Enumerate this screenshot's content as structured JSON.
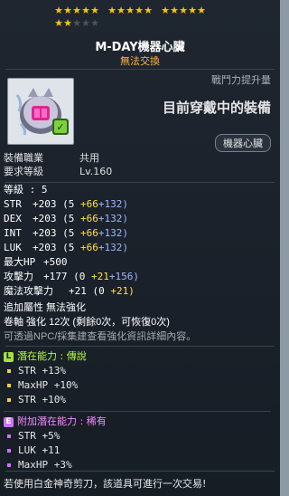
{
  "stars": {
    "filled": 17,
    "total": 20
  },
  "item": {
    "name": "M-DAY機器心臟",
    "subtitle": "無法交換",
    "icon": "mechanical-heart-icon"
  },
  "compare": {
    "label": "戰鬥力提升量",
    "main": "目前穿戴中的裝備",
    "badge": "機器心臟"
  },
  "requirements": [
    {
      "label": "裝備職業",
      "value": "共用"
    },
    {
      "label": "要求等級",
      "value": "Lv.160"
    }
  ],
  "stats": {
    "level": "等級 : 5",
    "lines": [
      {
        "name": "STR",
        "total": "+203",
        "open": "(5",
        "a": "+66",
        "b": "+132)"
      },
      {
        "name": "DEX",
        "total": "+203",
        "open": "(5",
        "a": "+66",
        "b": "+132)"
      },
      {
        "name": "INT",
        "total": "+203",
        "open": "(5",
        "a": "+66",
        "b": "+132)"
      },
      {
        "name": "LUK",
        "total": "+203",
        "open": "(5",
        "a": "+66",
        "b": "+132)"
      }
    ],
    "maxhp": {
      "name": "最大HP",
      "value": "+500"
    },
    "attack": {
      "name": "攻擊力",
      "total": "+177",
      "open": "(0",
      "a": "+21",
      "b": "+156)"
    },
    "magic": {
      "name": "魔法攻擊力",
      "total": "+21",
      "open": "(0",
      "a": "+21)"
    }
  },
  "extra": {
    "line1": "追加屬性 無法強化",
    "line2": "卷軸 強化 12次 (剩餘0次，可恢復0次)",
    "note": "可透過NPC/採集建查看強化資訊詳細內容。"
  },
  "potential": {
    "badge": "L",
    "title": "潛在能力 : 傳說",
    "lines": [
      "STR +13%",
      "MaxHP +10%",
      "STR +10%"
    ]
  },
  "additional": {
    "badge": "E",
    "title": "附加潛在能力 : 稀有",
    "lines": [
      "STR +5%",
      "LUK +11",
      "MaxHP +3%"
    ]
  },
  "trade_note": "若使用白金神奇剪刀，該道具可進行一次交易!"
}
